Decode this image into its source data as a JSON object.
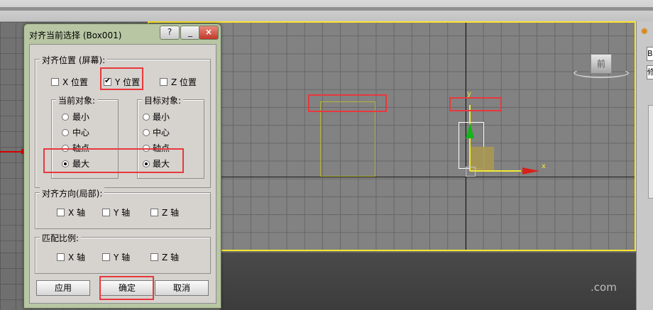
{
  "dialog": {
    "title": "对齐当前选择 (Box001)",
    "help_button": "?",
    "minimize_button": "_",
    "close_button": "×",
    "align_position": {
      "title": "对齐位置 (屏幕):",
      "x": {
        "label": "X 位置",
        "checked": false
      },
      "y": {
        "label": "Y 位置",
        "checked": true
      },
      "z": {
        "label": "Z 位置",
        "checked": false
      }
    },
    "current_object": {
      "title": "当前对象:",
      "options": [
        "最小",
        "中心",
        "轴点",
        "最大"
      ],
      "selected": "最大"
    },
    "target_object": {
      "title": "目标对象:",
      "options": [
        "最小",
        "中心",
        "轴点",
        "最大"
      ],
      "selected": "最大"
    },
    "align_orientation": {
      "title": "对齐方向(局部):",
      "x": "X 轴",
      "y": "Y 轴",
      "z": "Z 轴"
    },
    "match_scale": {
      "title": "匹配比例:",
      "x": "X 轴",
      "y": "Y 轴",
      "z": "Z 轴"
    },
    "buttons": {
      "apply": "应用",
      "ok": "确定",
      "cancel": "取消"
    }
  },
  "viewport": {
    "viewcube_label": "前",
    "gizmo_x_label": "x",
    "gizmo_y_label": "y",
    "watermark": ".com"
  },
  "right_panel": {
    "field1": "B",
    "field2": "修"
  },
  "colors": {
    "viewport_border": "#ffe52b",
    "highlight": "#e8383d",
    "axis_x": "#d8201b",
    "axis_y": "#15b31a",
    "gizmo": "#f2ea37"
  }
}
